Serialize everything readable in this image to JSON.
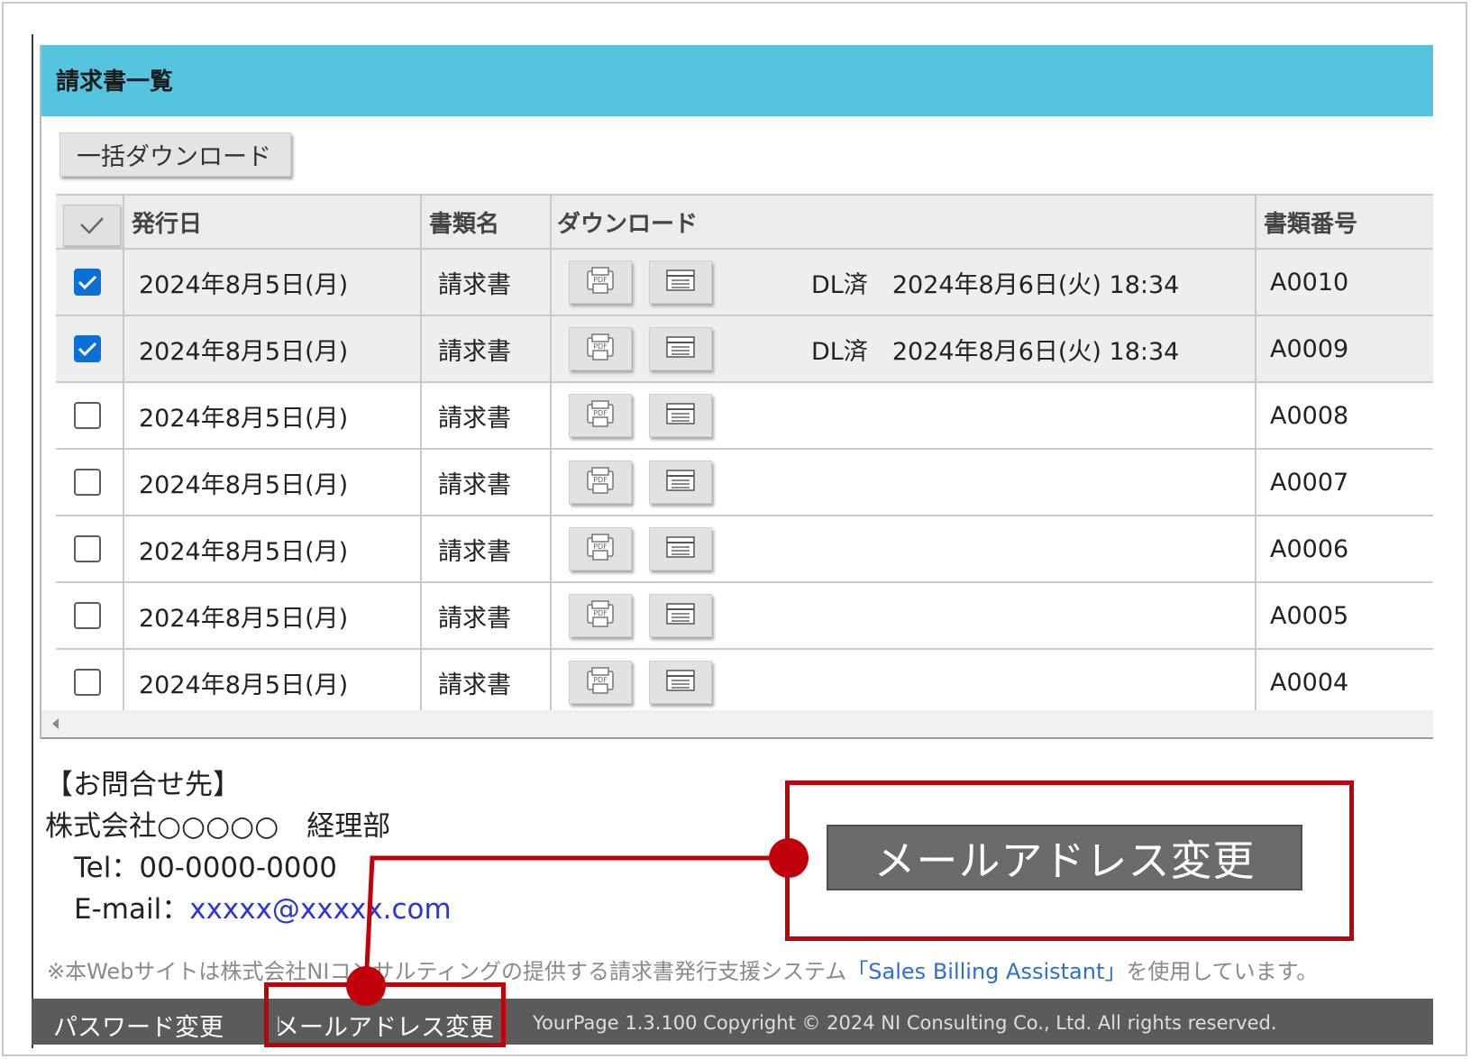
{
  "panel": {
    "title": "請求書一覧"
  },
  "toolbar": {
    "bulk_download_label": "一括ダウンロード"
  },
  "table": {
    "columns": {
      "issue_date": "発行日",
      "doc_name": "書類名",
      "download": "ダウンロード",
      "doc_number": "書類番号"
    },
    "rows": [
      {
        "checked": true,
        "date": "2024年8月5日(月)",
        "doc_name": "請求書",
        "status": "DL済　2024年8月6日(火) 18:34",
        "number": "A0010"
      },
      {
        "checked": true,
        "date": "2024年8月5日(月)",
        "doc_name": "請求書",
        "status": "DL済　2024年8月6日(火) 18:34",
        "number": "A0009"
      },
      {
        "checked": false,
        "date": "2024年8月5日(月)",
        "doc_name": "請求書",
        "status": "",
        "number": "A0008"
      },
      {
        "checked": false,
        "date": "2024年8月5日(月)",
        "doc_name": "請求書",
        "status": "",
        "number": "A0007"
      },
      {
        "checked": false,
        "date": "2024年8月5日(月)",
        "doc_name": "請求書",
        "status": "",
        "number": "A0006"
      },
      {
        "checked": false,
        "date": "2024年8月5日(月)",
        "doc_name": "請求書",
        "status": "",
        "number": "A0005"
      },
      {
        "checked": false,
        "date": "2024年8月5日(月)",
        "doc_name": "請求書",
        "status": "",
        "number": "A0004"
      }
    ],
    "icons": {
      "pdf": "pdf-icon",
      "detail": "list-icon"
    }
  },
  "contact": {
    "heading": "【お問合せ先】",
    "company": "株式会社○○○○○　経理部",
    "tel": "Tel：00-0000-0000",
    "email_label": "E-mail：",
    "email": "xxxxx@xxxxx.com"
  },
  "disclaimer": {
    "prefix": "※本Webサイトは株式会社NIコンサルティングの提供する請求書発行支援システム",
    "product": "「Sales Billing Assistant」",
    "suffix": "を使用しています。"
  },
  "footer": {
    "password_change": "パスワード変更",
    "separator": "|",
    "email_change": "メールアドレス変更",
    "copyright": "YourPage 1.3.100 Copyright © 2024 NI Consulting Co., Ltd. All rights reserved."
  },
  "callout": {
    "button_label": "メールアドレス変更",
    "color": "#c0000b"
  },
  "colors": {
    "header_bar": "#55c4df",
    "checkbox_checked": "#0a6fd6",
    "footer_bg": "#5b5b5b",
    "link": "#2b35d8"
  }
}
